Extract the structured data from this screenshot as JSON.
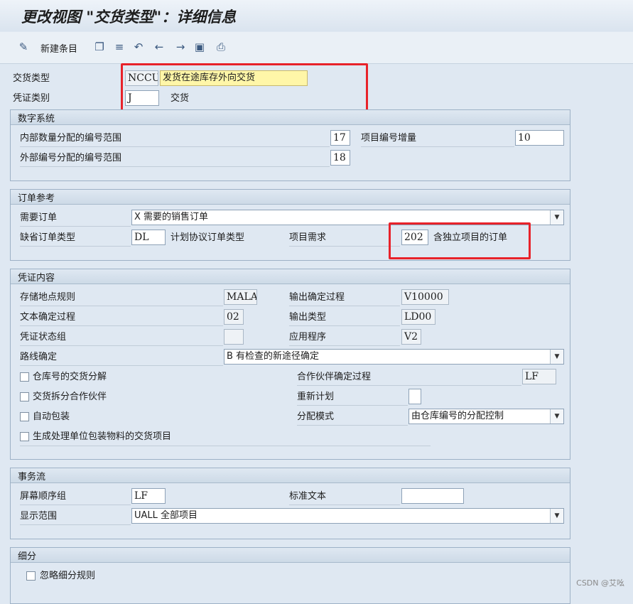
{
  "window": {
    "title": "更改视图 \"交货类型\"：详细信息"
  },
  "toolbar": {
    "new_entries": "新建条目"
  },
  "header": {
    "delivery_type_label": "交货类型",
    "delivery_type_code": "NCCU",
    "delivery_type_desc": "发货在途库存外向交货",
    "doc_category_label": "凭证类别",
    "doc_category_value": "J",
    "doc_category_desc": "交货"
  },
  "number_system": {
    "title": "数字系统",
    "internal_label": "内部数量分配的编号范围",
    "internal_value": "17",
    "item_inc_label": "项目编号增量",
    "item_inc_value": "10",
    "external_label": "外部编号分配的编号范围",
    "external_value": "18"
  },
  "order_ref": {
    "title": "订单参考",
    "order_required_label": "需要订单",
    "order_required_value": "X 需要的销售订单",
    "default_order_type_label": "缺省订单类型",
    "default_order_type_value": "DL",
    "sched_agreement_label": "计划协议订单类型",
    "item_req_label": "项目需求",
    "item_req_value": "202",
    "item_req_desc": "含独立项目的订单"
  },
  "doc_content": {
    "title": "凭证内容",
    "storage_rule_label": "存储地点规则",
    "storage_rule_value": "MALA",
    "output_proc_label": "输出确定过程",
    "output_proc_value": "V10000",
    "text_proc_label": "文本确定过程",
    "text_proc_value": "02",
    "output_type_label": "输出类型",
    "output_type_value": "LD00",
    "status_group_label": "凭证状态组",
    "status_group_value": "",
    "application_label": "应用程序",
    "application_value": "V2",
    "route_label": "路线确定",
    "route_value": "B 有检查的新途径确定",
    "split_whse_label": "仓库号的交货分解",
    "partner_proc_label": "合作伙伴确定过程",
    "partner_proc_value": "LF",
    "split_partner_label": "交货拆分合作伙伴",
    "reschedule_label": "重新计划",
    "reschedule_value": "",
    "auto_pack_label": "自动包装",
    "dist_mode_label": "分配模式",
    "dist_mode_value": "由仓库编号的分配控制",
    "gen_items_label": "生成处理单位包装物料的交货项目"
  },
  "transaction_flow": {
    "title": "事务流",
    "screen_seq_label": "屏幕顺序组",
    "screen_seq_value": "LF",
    "std_text_label": "标准文本",
    "std_text_value": "",
    "display_range_label": "显示范围",
    "display_range_value": "UALL 全部项目"
  },
  "breakdown": {
    "title": "细分",
    "ignore_label": "忽略细分规则"
  },
  "watermark": "CSDN @艾吆",
  "colors": {
    "highlight_border": "#e8222a",
    "yellow_field": "#fff6a8"
  }
}
